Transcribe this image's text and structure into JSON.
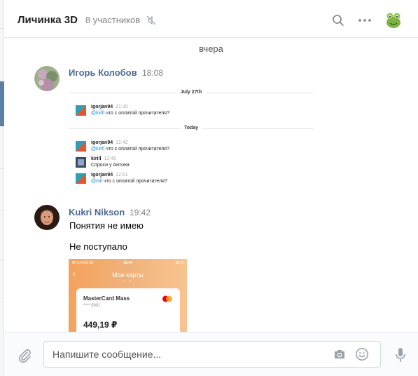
{
  "header": {
    "title": "Личинка 3D",
    "members": "8 участников"
  },
  "messages": {
    "day_separator": "вчера",
    "items": [
      {
        "author": "Игорь Колобов",
        "time": "18:08",
        "embed": {
          "sep1": "July 27th",
          "sep2": "Today",
          "rows": [
            {
              "user": "igorjan94",
              "time": "21:30",
              "mention": "@kirill",
              "text": " что с оплатой прочитателя?"
            },
            {
              "user": "igorjan94",
              "time": "12:42",
              "mention": "@kirill",
              "text": " что с оплатой прочитателя?"
            },
            {
              "user": "kirill",
              "time": "12:45",
              "mention": "",
              "text": "Спроси у Антона"
            },
            {
              "user": "igorjan94",
              "time": "12:51",
              "mention": "@mil",
              "text": " что с оплатой прочитателя?"
            }
          ]
        }
      },
      {
        "author": "Kukri Nikson",
        "time": "19:42",
        "text1": "Понятия не имею",
        "text2": "Не поступало",
        "attachment": {
          "carrier": "MTS RUS  3G",
          "clock": "19:44",
          "battery": "50 %",
          "screen_title": "Мои карты",
          "card_name": "MasterCard Mass",
          "card_number": "**** 5001",
          "balance": "449,19 ₽"
        }
      }
    ]
  },
  "composer": {
    "placeholder": "Напишите сообщение..."
  },
  "colors": {
    "accent": "#5b7fa6",
    "author": "#4a6a93",
    "muted": "#828282"
  }
}
